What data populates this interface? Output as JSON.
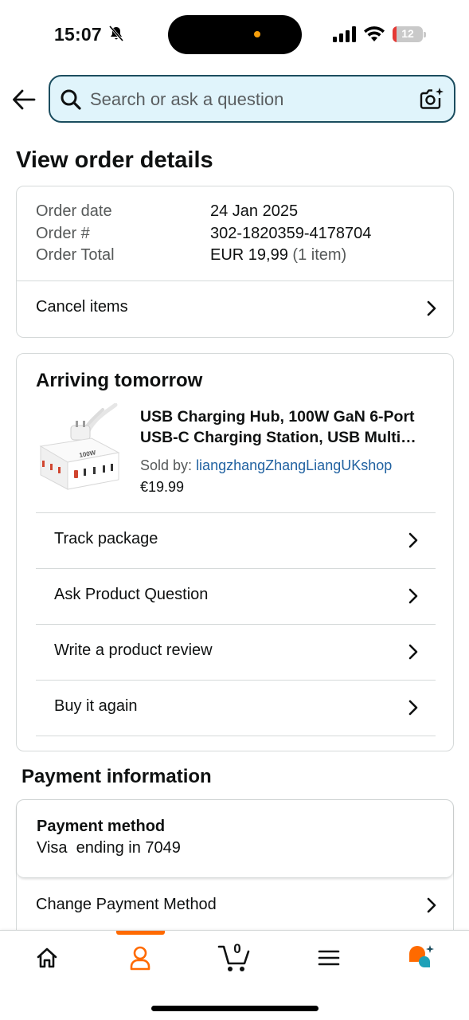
{
  "status_bar": {
    "time": "15:07",
    "battery_level": "12",
    "battery_fraction": 0.12,
    "battery_color": "#e53935"
  },
  "search": {
    "placeholder": "Search or ask a question",
    "value": ""
  },
  "page": {
    "title": "View order details"
  },
  "order_summary": {
    "rows": [
      {
        "label": "Order date",
        "value": "24 Jan 2025"
      },
      {
        "label": "Order #",
        "value": "302-1820359-4178704"
      },
      {
        "label": "Order Total",
        "value": "EUR 19,99",
        "extra": "(1 item)"
      }
    ],
    "cancel_label": "Cancel items"
  },
  "shipment": {
    "status": "Arriving tomorrow",
    "product": {
      "title_line1": "USB Charging Hub, 100W GaN 6-Port",
      "title_line2": "USB-C Charging Station, USB Multi…",
      "sold_by_label": "Sold by:",
      "seller": "liangzhangZhangLiangUKshop",
      "price": "€19.99",
      "image_text": "100W"
    },
    "actions": [
      {
        "label": "Track package"
      },
      {
        "label": "Ask Product Question"
      },
      {
        "label": "Write a product review"
      },
      {
        "label": "Buy it again"
      }
    ]
  },
  "payment": {
    "section_title": "Payment information",
    "method_heading": "Payment method",
    "method_value": "Visa  ending in 7049",
    "change_label": "Change Payment Method"
  },
  "bottom_nav": {
    "items": [
      {
        "icon": "home-icon"
      },
      {
        "icon": "account-icon",
        "active": true
      },
      {
        "icon": "cart-icon"
      },
      {
        "icon": "menu-icon"
      },
      {
        "icon": "rufus-assistant-icon"
      }
    ],
    "cart_count": "0",
    "accent_color": "#ff6a00"
  },
  "colors": {
    "link": "#2162a1",
    "search_bg": "#e0f4fb",
    "search_border": "#1b4d5f",
    "border": "#d5d9d9"
  }
}
